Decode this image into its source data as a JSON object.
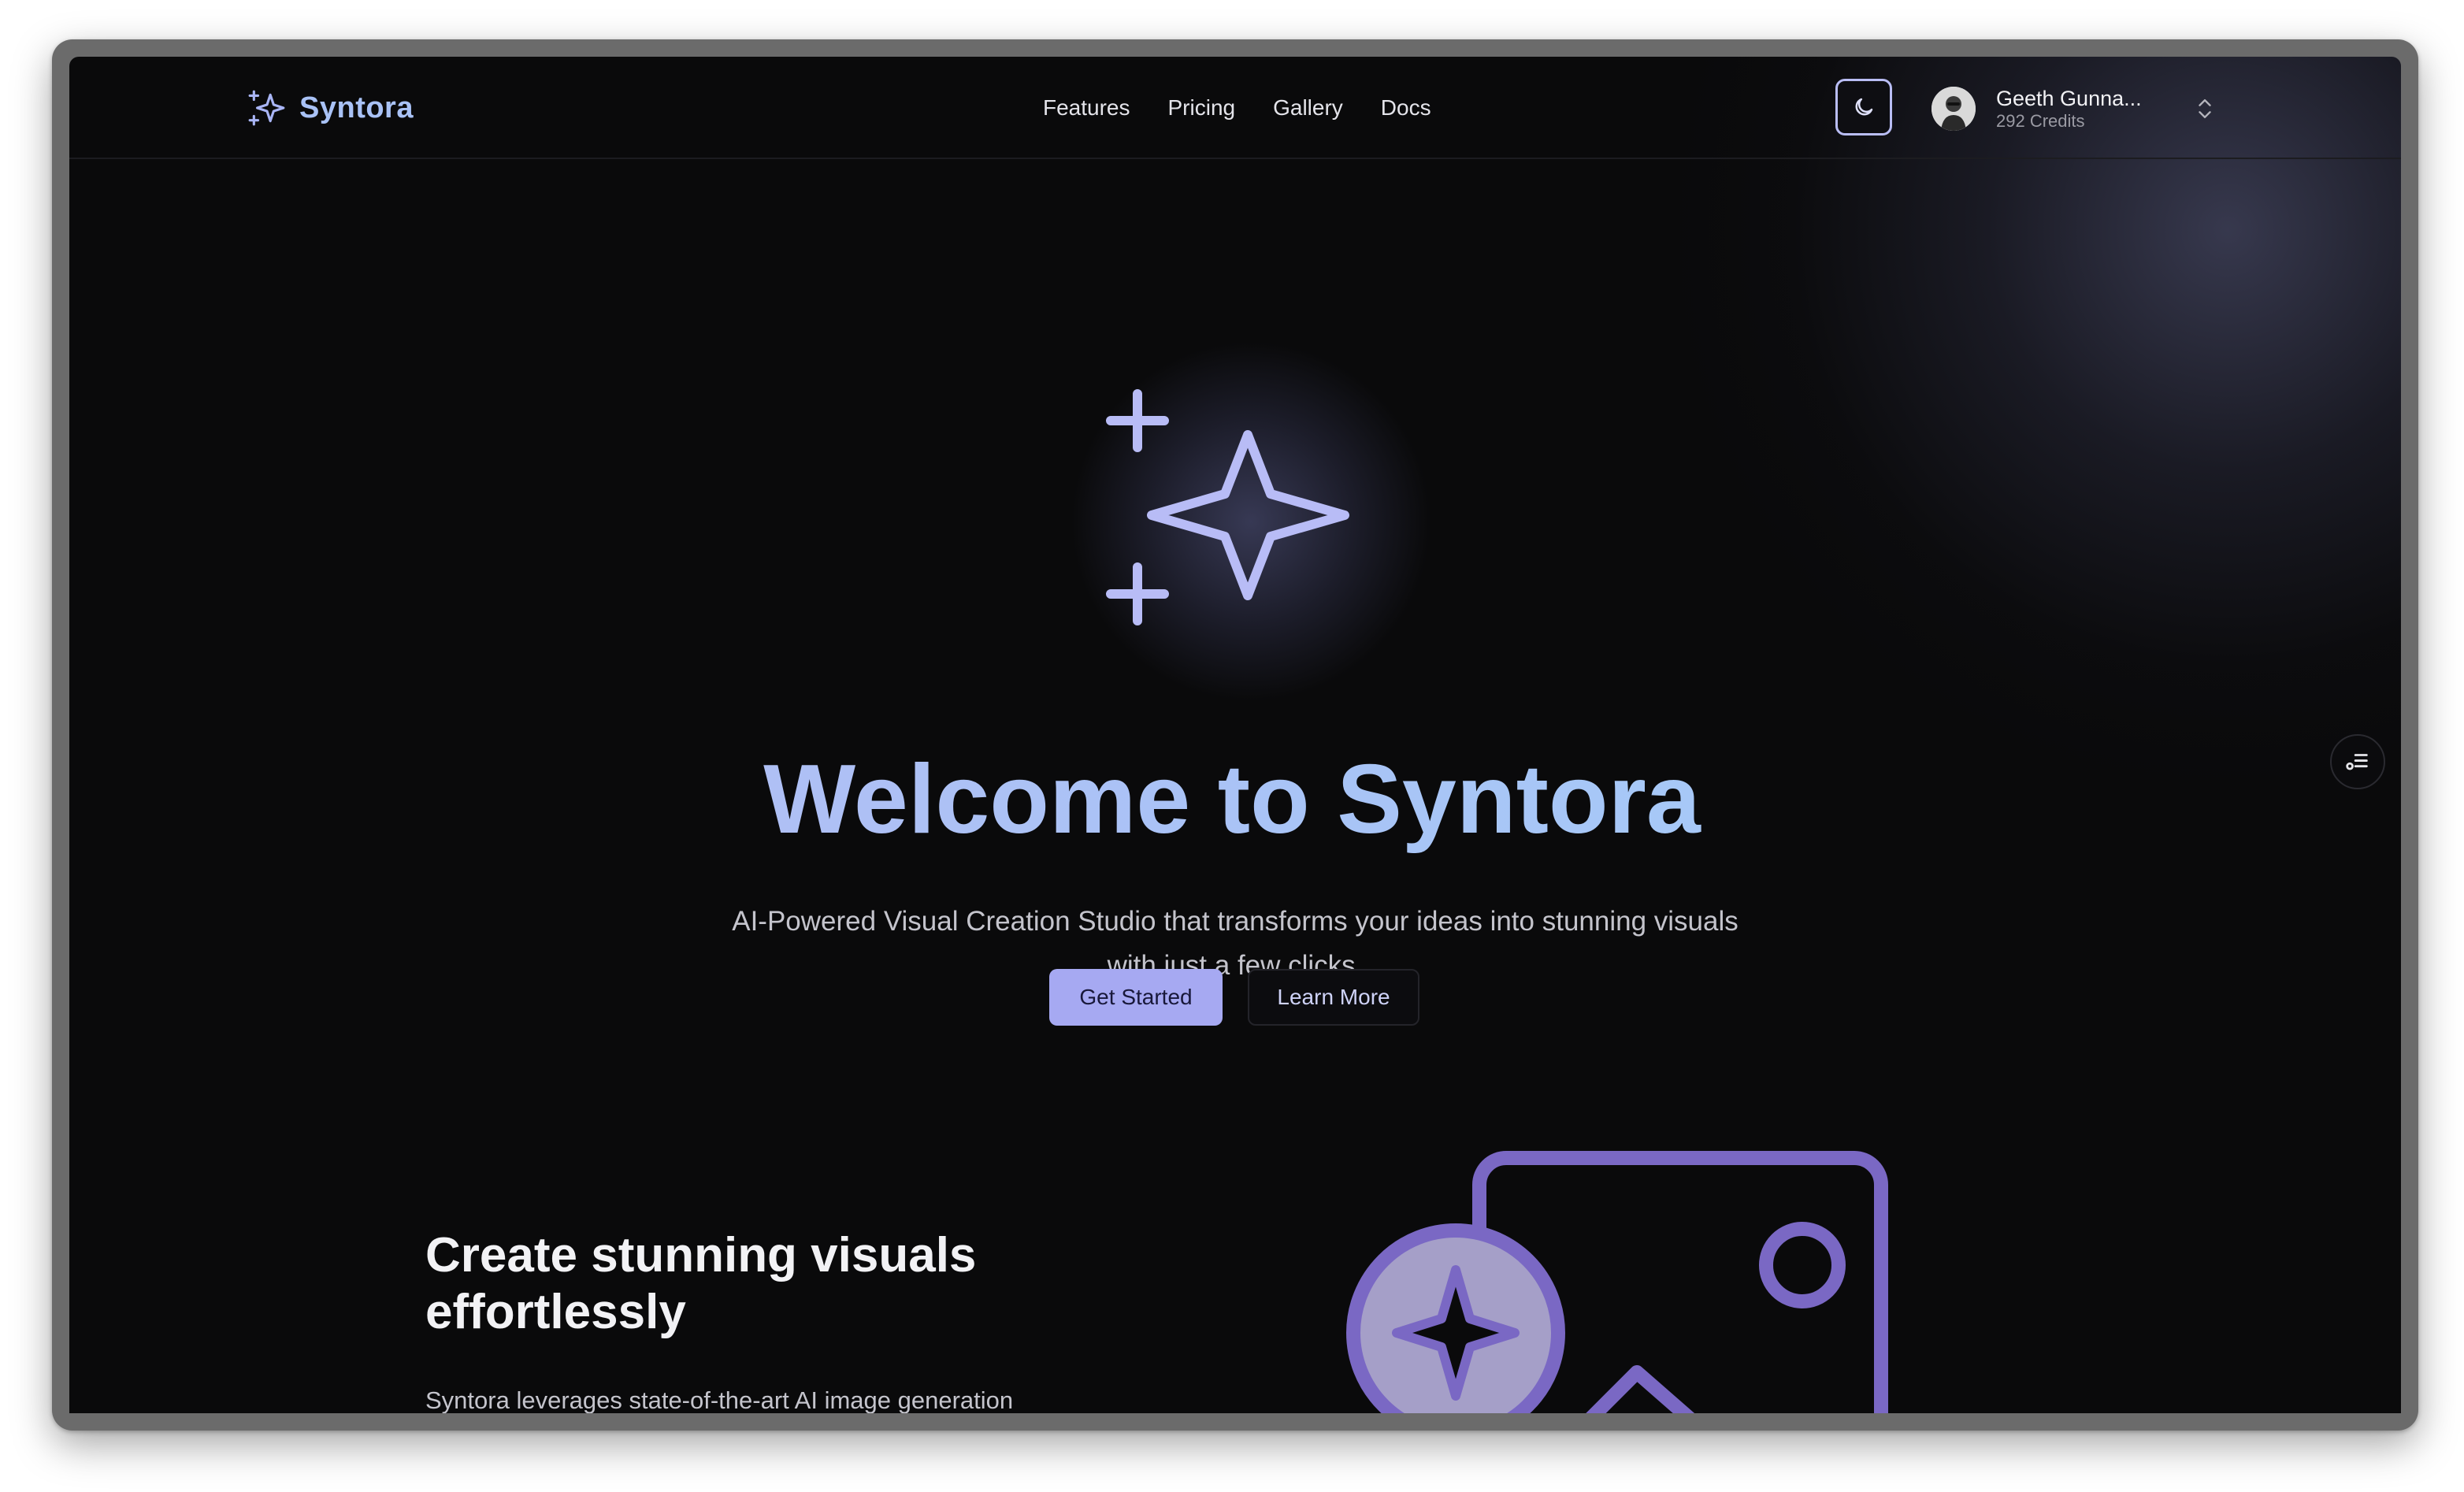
{
  "brand": {
    "name": "Syntora"
  },
  "nav": {
    "links": [
      {
        "label": "Features"
      },
      {
        "label": "Pricing"
      },
      {
        "label": "Gallery"
      },
      {
        "label": "Docs"
      }
    ]
  },
  "user": {
    "name": "Geeth Gunna...",
    "credits": "292 Credits"
  },
  "hero": {
    "title": "Welcome to Syntora",
    "subtitle": "AI-Powered Visual Creation Studio that transforms your ideas into stunning visuals with just a few clicks.",
    "primary_button": "Get Started",
    "secondary_button": "Learn More"
  },
  "section": {
    "title": "Create stunning visuals effortlessly",
    "body": "Syntora leverages state-of-the-art AI image generation"
  },
  "icons": {
    "brand": "sparkles-icon",
    "theme": "moon-icon",
    "user_menu": "chevron-up-down-icon",
    "hero": "sparkles-icon",
    "toc": "list-icon",
    "illustration": "image-ai-icon"
  },
  "colors": {
    "accent": "#a6a9f2",
    "brand_text": "#a9c2f6",
    "background": "#0a0a0b",
    "illustration": "#7a68c4"
  }
}
